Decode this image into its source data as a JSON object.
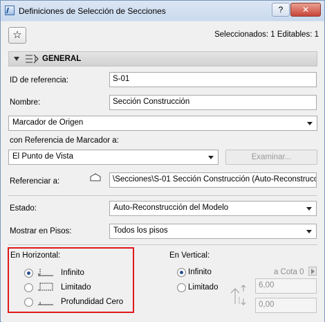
{
  "window": {
    "title": "Definiciones de Selección de Secciones",
    "help_label": "?",
    "close_label": "✕"
  },
  "toolbar": {
    "favorites_icon": "star-icon",
    "selection_info": "Seleccionados: 1 Editables: 1"
  },
  "section": {
    "title": "GENERAL"
  },
  "form": {
    "reference_id_label": "ID de referencia:",
    "reference_id_value": "S-01",
    "name_label": "Nombre:",
    "name_value": "Sección Construcción",
    "marker_type_value": "Marcador de Origen",
    "marker_ref_label": "con Referencia de Marcador a:",
    "marker_ref_value": "El Punto de Vista",
    "browse_label": "Examinar...",
    "refer_to_label": "Referenciar a:",
    "refer_to_value": "\\Secciones\\S-01 Sección Construcción (Auto-Reconstrucci",
    "status_label": "Estado:",
    "status_value": "Auto-Reconstrucción del Modelo",
    "show_on_floors_label": "Mostrar en Pisos:",
    "show_on_floors_value": "Todos los pisos"
  },
  "horizontal": {
    "label": "En Horizontal:",
    "options": [
      {
        "label": "Infinito",
        "checked": true
      },
      {
        "label": "Limitado",
        "checked": false
      },
      {
        "label": "Profundidad Cero",
        "checked": false
      }
    ]
  },
  "vertical": {
    "label": "En Vertical:",
    "options": [
      {
        "label": "Infinito",
        "checked": true
      },
      {
        "label": "Limitado",
        "checked": false
      }
    ],
    "cota_label": "a Cota 0",
    "top_value": "6,00",
    "bottom_value": "0,00"
  },
  "colors": {
    "highlight_border": "#e0181a",
    "radio_dot": "#2a4f8c"
  }
}
